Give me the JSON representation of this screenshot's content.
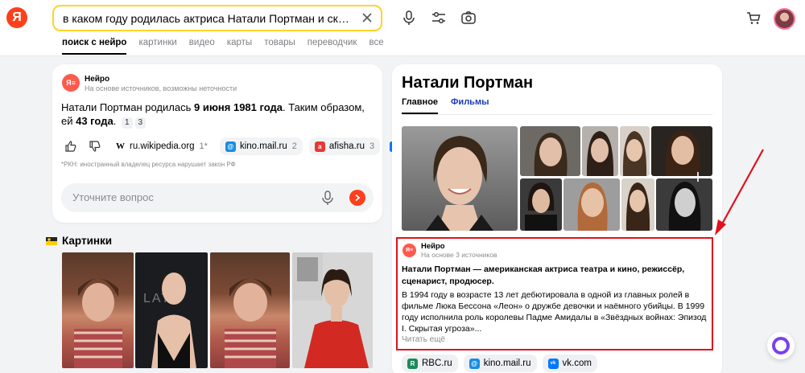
{
  "header": {
    "logo_letter": "Я",
    "search_query": "в каком году родилась актриса Натали Портман и сколько ей лет...",
    "tabs": [
      "поиск с нейро",
      "картинки",
      "видео",
      "карты",
      "товары",
      "переводчик",
      "все"
    ]
  },
  "neuro": {
    "logo_text": "Я≡",
    "title": "Нейро",
    "subtitle": "На основе источников, возможны неточности",
    "answer_pre": "Натали Портман родилась ",
    "answer_date": "9 июня 1981 года",
    "answer_mid": ". Таким образом, ей ",
    "answer_age": "43 года",
    "answer_end": ".",
    "ref1": "1",
    "ref2": "3",
    "sources": [
      {
        "name": "ru.wikipedia.org",
        "count": "1*",
        "fav": "W"
      },
      {
        "name": "kino.mail.ru",
        "count": "2",
        "fav": "@"
      },
      {
        "name": "afisha.ru",
        "count": "3",
        "fav": "a"
      }
    ],
    "disclaimer": "*РКН: иностранный владелец ресурса нарушает закон РФ",
    "ask_placeholder": "Уточните вопрос"
  },
  "images": {
    "title": "Картинки"
  },
  "knowledge": {
    "name": "Натали Портман",
    "tabs": [
      "Главное",
      "Фильмы"
    ],
    "neuro_title": "Нейро",
    "neuro_sub": "На основе 3 источников",
    "lead": "Натали Портман — американская актриса театра и кино, режиссёр, сценарист, продюсер.",
    "body": "В 1994 году в возрасте 13 лет дебютировала в одной из главных ролей в фильме Люка Бессона «Леон» о дружбе девочки и наёмного убийцы. В 1999 году исполнила роль королевы Падме Амидалы в «Звёздных войнах: Эпизод I. Скрытая угроза»...",
    "more": "Читать ещё",
    "sources": [
      {
        "name": "RBC.ru",
        "fav": "R"
      },
      {
        "name": "kino.mail.ru",
        "fav": "@"
      },
      {
        "name": "vk.com",
        "fav": "vk"
      }
    ]
  },
  "colors": {
    "accent_red": "#fc3f1d",
    "search_border": "#fed42b",
    "highlight_box": "#e0121b",
    "link_blue": "#1a3dba"
  }
}
